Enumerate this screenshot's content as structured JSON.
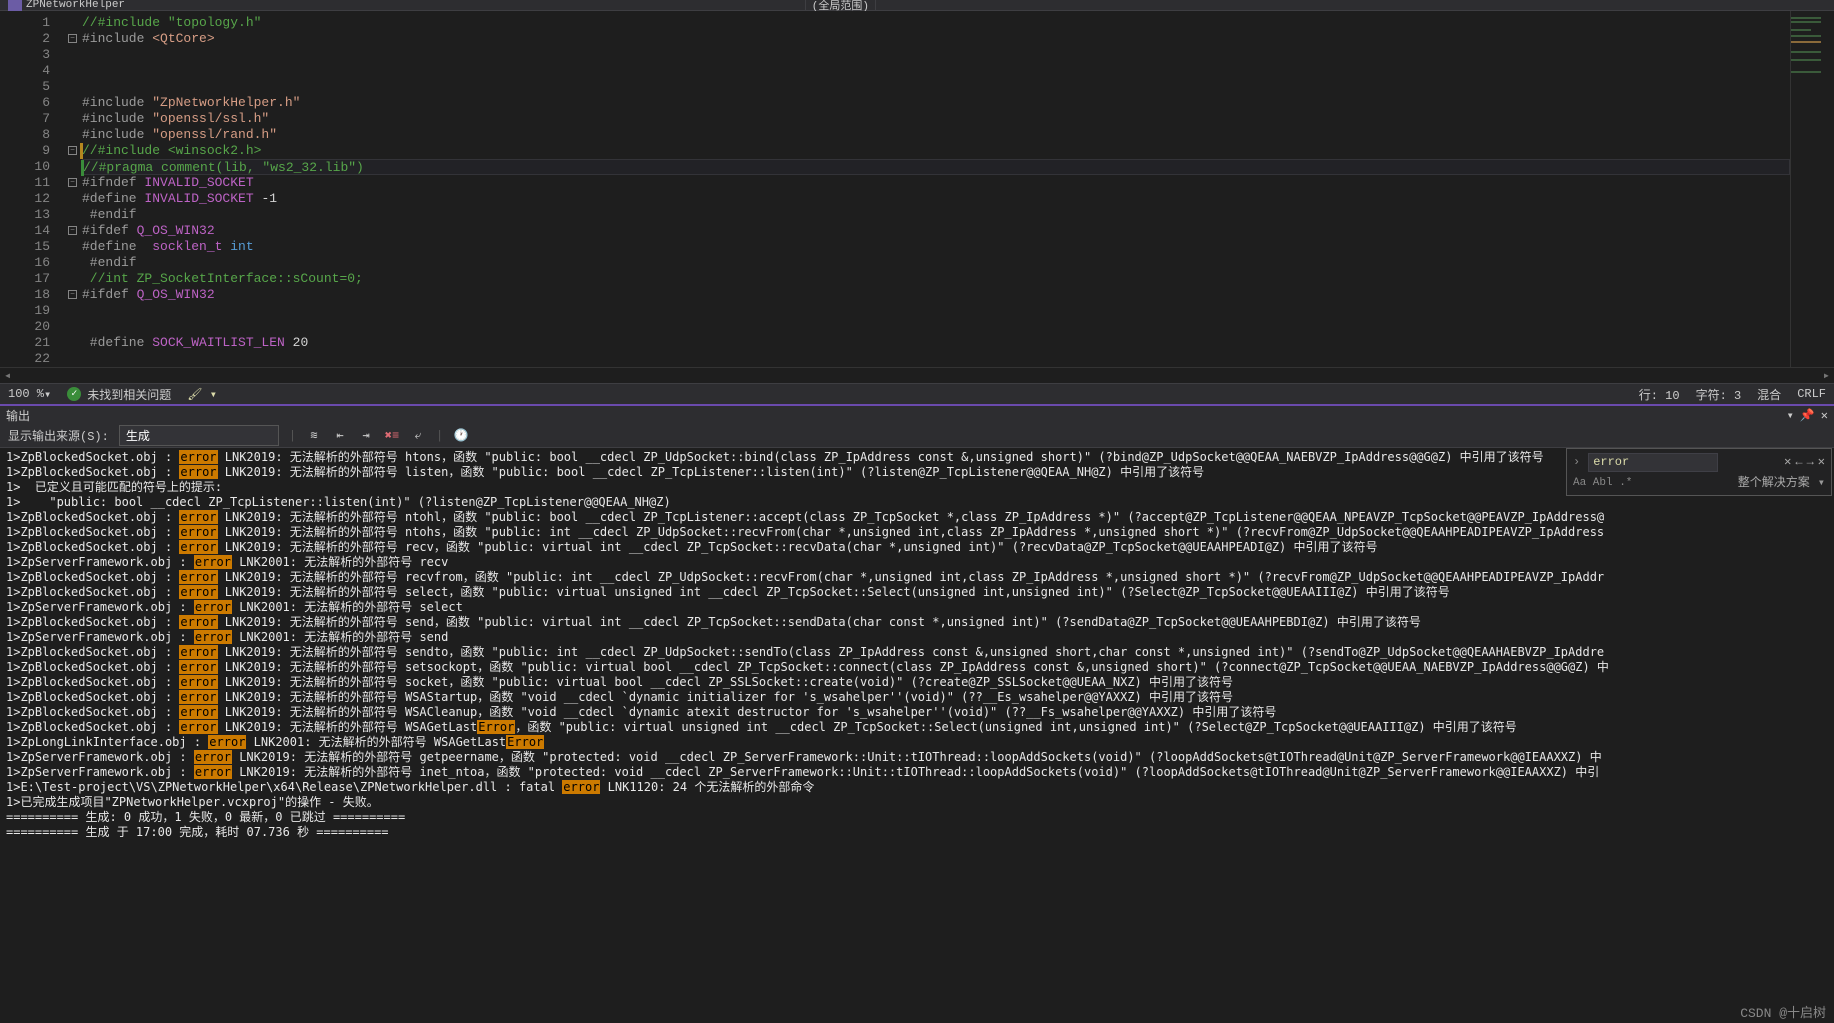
{
  "topbar": {
    "title": "ZPNetworkHelper",
    "scope": "(全局范围)"
  },
  "code": {
    "lines": [
      {
        "n": 1,
        "fold": "",
        "seg": [
          {
            "c": "c-comment",
            "t": "//#include \"topology.h\""
          }
        ]
      },
      {
        "n": 2,
        "fold": "-",
        "seg": [
          {
            "c": "c-preproc",
            "t": "#include "
          },
          {
            "c": "c-include",
            "t": "<QtCore>"
          }
        ]
      },
      {
        "n": 3,
        "fold": "",
        "seg": []
      },
      {
        "n": 4,
        "fold": "",
        "seg": []
      },
      {
        "n": 5,
        "fold": "",
        "seg": []
      },
      {
        "n": 6,
        "fold": "",
        "seg": [
          {
            "c": "c-preproc",
            "t": "#include "
          },
          {
            "c": "c-include",
            "t": "\"ZpNetworkHelper.h\""
          }
        ]
      },
      {
        "n": 7,
        "fold": "",
        "seg": [
          {
            "c": "c-preproc",
            "t": "#include "
          },
          {
            "c": "c-include",
            "t": "\"openssl/ssl.h\""
          }
        ]
      },
      {
        "n": 8,
        "fold": "",
        "seg": [
          {
            "c": "c-preproc",
            "t": "#include "
          },
          {
            "c": "c-include",
            "t": "\"openssl/rand.h\""
          }
        ]
      },
      {
        "n": 9,
        "fold": "-",
        "bar": "dirty",
        "seg": [
          {
            "c": "c-comment",
            "t": "//#include <winsock2.h>"
          }
        ]
      },
      {
        "n": 10,
        "fold": "",
        "bar": "green",
        "hl": true,
        "seg": [
          {
            "c": "c-comment",
            "t": "//#pragma comment(lib, \"ws2_32.lib\")"
          }
        ]
      },
      {
        "n": 11,
        "fold": "-",
        "seg": [
          {
            "c": "c-preproc",
            "t": "#ifndef "
          },
          {
            "c": "c-macro",
            "t": "INVALID_SOCKET"
          }
        ]
      },
      {
        "n": 12,
        "fold": "",
        "seg": [
          {
            "c": "c-preproc",
            "t": "#define "
          },
          {
            "c": "c-macro",
            "t": "INVALID_SOCKET"
          },
          {
            "c": "c-plain",
            "t": " -1"
          }
        ]
      },
      {
        "n": 13,
        "fold": "",
        "seg": [
          {
            "c": "c-preproc",
            "t": " #endif"
          }
        ]
      },
      {
        "n": 14,
        "fold": "-",
        "seg": [
          {
            "c": "c-preproc",
            "t": "#ifdef "
          },
          {
            "c": "c-macro",
            "t": "Q_OS_WIN32"
          }
        ]
      },
      {
        "n": 15,
        "fold": "",
        "seg": [
          {
            "c": "c-preproc",
            "t": "#define  "
          },
          {
            "c": "c-macro",
            "t": "socklen_t"
          },
          {
            "c": "c-plain",
            "t": " "
          },
          {
            "c": "c-keyword",
            "t": "int"
          }
        ]
      },
      {
        "n": 16,
        "fold": "",
        "seg": [
          {
            "c": "c-preproc",
            "t": " #endif"
          }
        ]
      },
      {
        "n": 17,
        "fold": "",
        "seg": [
          {
            "c": "c-comment",
            "t": " //int ZP_SocketInterface::sCount=0;"
          }
        ]
      },
      {
        "n": 18,
        "fold": "-",
        "seg": [
          {
            "c": "c-preproc",
            "t": "#ifdef "
          },
          {
            "c": "c-macro",
            "t": "Q_OS_WIN32"
          }
        ]
      },
      {
        "n": 19,
        "fold": "",
        "seg": []
      },
      {
        "n": 20,
        "fold": "",
        "seg": []
      },
      {
        "n": 21,
        "fold": "",
        "seg": [
          {
            "c": "c-preproc",
            "t": " #define "
          },
          {
            "c": "c-macro",
            "t": "SOCK_WAITLIST_LEN"
          },
          {
            "c": "c-plain",
            "t": " 20"
          }
        ]
      },
      {
        "n": 22,
        "fold": "",
        "seg": []
      }
    ]
  },
  "status": {
    "zoom": "100 %",
    "issues": "未找到相关问题",
    "line": "行: 10",
    "char": "字符: 3",
    "mixed": "混合",
    "crlf": "CRLF"
  },
  "output_header": "输出",
  "output_toolbar": {
    "label": "显示输出来源(S):",
    "source": "生成"
  },
  "find": {
    "value": "error",
    "scope": "整个解决方案",
    "opts": "Aa Abl .*"
  },
  "output": [
    {
      "pre": "1>ZpBlockedSocket.obj : ",
      "err": "error",
      "post": " LNK2019: 无法解析的外部符号 htons，函数 \"public: bool __cdecl ZP_UdpSocket::bind(class ZP_IpAddress const &,unsigned short)\" (?bind@ZP_UdpSocket@@QEAA_NAEBVZP_IpAddress@@G@Z) 中引用了该符号"
    },
    {
      "pre": "1>ZpBlockedSocket.obj : ",
      "err": "error",
      "post": " LNK2019: 无法解析的外部符号 listen，函数 \"public: bool __cdecl ZP_TcpListener::listen(int)\" (?listen@ZP_TcpListener@@QEAA_NH@Z) 中引用了该符号"
    },
    {
      "pre": "1>  已定义且可能匹配的符号上的提示:",
      "err": "",
      "post": ""
    },
    {
      "pre": "1>    \"public: bool __cdecl ZP_TcpListener::listen(int)\" (?listen@ZP_TcpListener@@QEAA_NH@Z)",
      "err": "",
      "post": ""
    },
    {
      "pre": "1>ZpBlockedSocket.obj : ",
      "err": "error",
      "post": " LNK2019: 无法解析的外部符号 ntohl，函数 \"public: bool __cdecl ZP_TcpListener::accept(class ZP_TcpSocket *,class ZP_IpAddress *)\" (?accept@ZP_TcpListener@@QEAA_NPEAVZP_TcpSocket@@PEAVZP_IpAddress@"
    },
    {
      "pre": "1>ZpBlockedSocket.obj : ",
      "err": "error",
      "post": " LNK2019: 无法解析的外部符号 ntohs，函数 \"public: int __cdecl ZP_UdpSocket::recvFrom(char *,unsigned int,class ZP_IpAddress *,unsigned short *)\" (?recvFrom@ZP_UdpSocket@@QEAAHPEADIPEAVZP_IpAddress"
    },
    {
      "pre": "1>ZpBlockedSocket.obj : ",
      "err": "error",
      "post": " LNK2019: 无法解析的外部符号 recv，函数 \"public: virtual int __cdecl ZP_TcpSocket::recvData(char *,unsigned int)\" (?recvData@ZP_TcpSocket@@UEAAHPEADI@Z) 中引用了该符号"
    },
    {
      "pre": "1>ZpServerFramework.obj : ",
      "err": "error",
      "post": " LNK2001: 无法解析的外部符号 recv"
    },
    {
      "pre": "1>ZpBlockedSocket.obj : ",
      "err": "error",
      "post": " LNK2019: 无法解析的外部符号 recvfrom，函数 \"public: int __cdecl ZP_UdpSocket::recvFrom(char *,unsigned int,class ZP_IpAddress *,unsigned short *)\" (?recvFrom@ZP_UdpSocket@@QEAAHPEADIPEAVZP_IpAddr"
    },
    {
      "pre": "1>ZpBlockedSocket.obj : ",
      "err": "error",
      "post": " LNK2019: 无法解析的外部符号 select，函数 \"public: virtual unsigned int __cdecl ZP_TcpSocket::Select(unsigned int,unsigned int)\" (?Select@ZP_TcpSocket@@UEAAIII@Z) 中引用了该符号"
    },
    {
      "pre": "1>ZpServerFramework.obj : ",
      "err": "error",
      "post": " LNK2001: 无法解析的外部符号 select"
    },
    {
      "pre": "1>ZpBlockedSocket.obj : ",
      "err": "error",
      "post": " LNK2019: 无法解析的外部符号 send，函数 \"public: virtual int __cdecl ZP_TcpSocket::sendData(char const *,unsigned int)\" (?sendData@ZP_TcpSocket@@UEAAHPEBDI@Z) 中引用了该符号"
    },
    {
      "pre": "1>ZpServerFramework.obj : ",
      "err": "error",
      "post": " LNK2001: 无法解析的外部符号 send"
    },
    {
      "pre": "1>ZpBlockedSocket.obj : ",
      "err": "error",
      "post": " LNK2019: 无法解析的外部符号 sendto，函数 \"public: int __cdecl ZP_UdpSocket::sendTo(class ZP_IpAddress const &,unsigned short,char const *,unsigned int)\" (?sendTo@ZP_UdpSocket@@QEAAHAEBVZP_IpAddre"
    },
    {
      "pre": "1>ZpBlockedSocket.obj : ",
      "err": "error",
      "post": " LNK2019: 无法解析的外部符号 setsockopt，函数 \"public: virtual bool __cdecl ZP_TcpSocket::connect(class ZP_IpAddress const &,unsigned short)\" (?connect@ZP_TcpSocket@@UEAA_NAEBVZP_IpAddress@@G@Z) 中"
    },
    {
      "pre": "1>ZpBlockedSocket.obj : ",
      "err": "error",
      "post": " LNK2019: 无法解析的外部符号 socket，函数 \"public: virtual bool __cdecl ZP_SSLSocket::create(void)\" (?create@ZP_SSLSocket@@UEAA_NXZ) 中引用了该符号"
    },
    {
      "pre": "1>ZpBlockedSocket.obj : ",
      "err": "error",
      "post": " LNK2019: 无法解析的外部符号 WSAStartup，函数 \"void __cdecl `dynamic initializer for 's_wsahelper''(void)\" (??__Es_wsahelper@@YAXXZ) 中引用了该符号"
    },
    {
      "pre": "1>ZpBlockedSocket.obj : ",
      "err": "error",
      "post": " LNK2019: 无法解析的外部符号 WSACleanup，函数 \"void __cdecl `dynamic atexit destructor for 's_wsahelper''(void)\" (??__Fs_wsahelper@@YAXXZ) 中引用了该符号"
    },
    {
      "pre": "1>ZpBlockedSocket.obj : ",
      "err": "error",
      "post": " LNK2019: 无法解析的外部符号 WSAGetLast",
      "err2": "Error",
      "post2": "，函数 \"public: virtual unsigned int __cdecl ZP_TcpSocket::Select(unsigned int,unsigned int)\" (?Select@ZP_TcpSocket@@UEAAIII@Z) 中引用了该符号"
    },
    {
      "pre": "1>ZpLongLinkInterface.obj : ",
      "err": "error",
      "post": " LNK2001: 无法解析的外部符号 WSAGetLast",
      "err2": "Error",
      "post2": ""
    },
    {
      "pre": "1>ZpServerFramework.obj : ",
      "err": "error",
      "post": " LNK2019: 无法解析的外部符号 getpeername，函数 \"protected: void __cdecl ZP_ServerFramework::Unit::tIOThread::loopAddSockets(void)\" (?loopAddSockets@tIOThread@Unit@ZP_ServerFramework@@IEAAXXZ) 中"
    },
    {
      "pre": "1>ZpServerFramework.obj : ",
      "err": "error",
      "post": " LNK2019: 无法解析的外部符号 inet_ntoa，函数 \"protected: void __cdecl ZP_ServerFramework::Unit::tIOThread::loopAddSockets(void)\" (?loopAddSockets@tIOThread@Unit@ZP_ServerFramework@@IEAAXXZ) 中引"
    },
    {
      "pre": "1>E:\\Test-project\\VS\\ZPNetworkHelper\\x64\\Release\\ZPNetworkHelper.dll : fatal ",
      "err": "error",
      "post": " LNK1120: 24 个无法解析的外部命令"
    },
    {
      "pre": "1>已完成生成项目\"ZPNetworkHelper.vcxproj\"的操作 - 失败。",
      "err": "",
      "post": ""
    },
    {
      "pre": "========== 生成: 0 成功，1 失败，0 最新，0 已跳过 ==========",
      "err": "",
      "post": ""
    },
    {
      "pre": "========== 生成 于 17:00 完成，耗时 07.736 秒 ==========",
      "err": "",
      "post": ""
    }
  ],
  "watermark": "CSDN @十启树"
}
